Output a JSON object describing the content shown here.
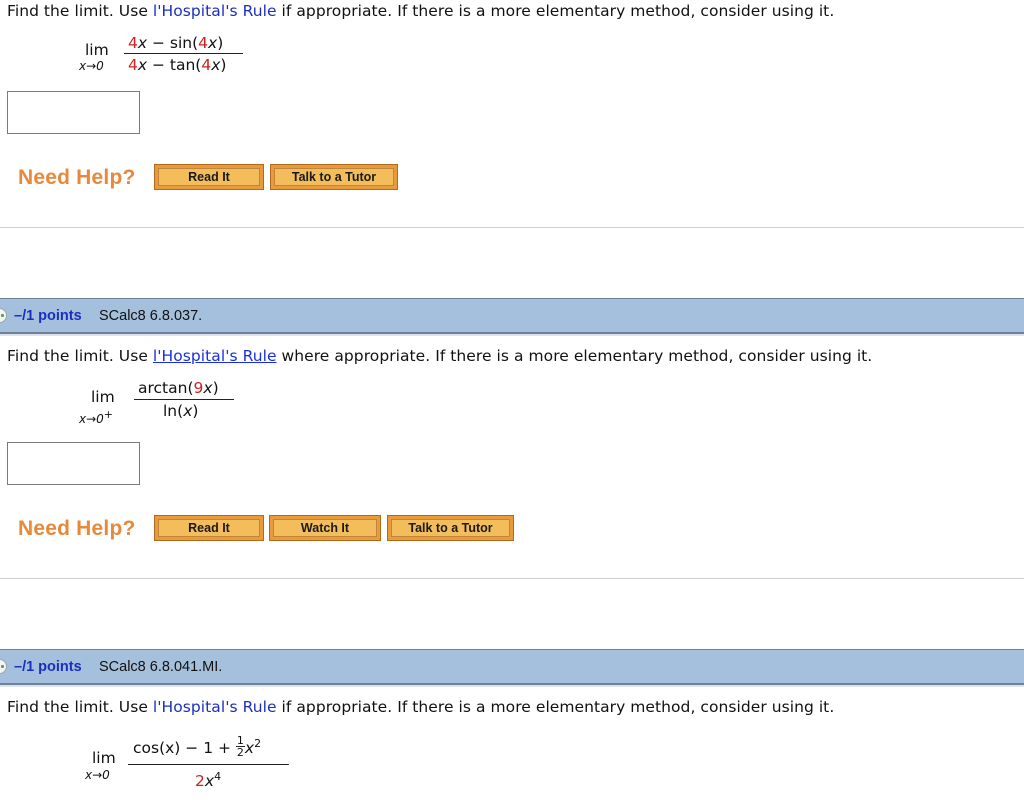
{
  "questions": [
    {
      "instruction": {
        "prefix": "Find the limit. Use ",
        "link": "l'Hospital's Rule",
        "suffix": " if appropriate. If there is a more elementary method, consider using it."
      },
      "limit": {
        "lim": "lim",
        "approach": "x→0",
        "numerator": [
          {
            "t": "4",
            "red": true
          },
          {
            "t": "x",
            "it": true
          },
          {
            "t": " − sin("
          },
          {
            "t": "4",
            "red": true
          },
          {
            "t": "x",
            "it": true
          },
          {
            "t": ")"
          }
        ],
        "denominator": [
          {
            "t": "4",
            "red": true
          },
          {
            "t": "x",
            "it": true
          },
          {
            "t": " − tan("
          },
          {
            "t": "4",
            "red": true
          },
          {
            "t": "x",
            "it": true
          },
          {
            "t": ")"
          }
        ]
      },
      "answer_value": "",
      "need_help": "Need Help?",
      "help_buttons": [
        "Read It",
        "Talk to a Tutor"
      ]
    },
    {
      "header": {
        "points": "–/1 points",
        "id": "SCalc8 6.8.037."
      },
      "instruction": {
        "prefix": "Find the limit. Use ",
        "link": "l'Hospital's Rule",
        "suffix": " where appropriate. If there is a more elementary method, consider using it."
      },
      "limit": {
        "lim": "lim",
        "approach": "x→0",
        "approach_sup": "+",
        "numerator": [
          {
            "t": "arctan("
          },
          {
            "t": "9",
            "red": true
          },
          {
            "t": "x",
            "it": true
          },
          {
            "t": ")"
          }
        ],
        "denominator": [
          {
            "t": "ln("
          },
          {
            "t": "x",
            "it": true
          },
          {
            "t": ")"
          }
        ]
      },
      "answer_value": "",
      "need_help": "Need Help?",
      "help_buttons": [
        "Read It",
        "Watch It",
        "Talk to a Tutor"
      ]
    },
    {
      "header": {
        "points": "–/1 points",
        "id": "SCalc8 6.8.041.MI."
      },
      "instruction": {
        "prefix": "Find the limit. Use ",
        "link": "l'Hospital's Rule",
        "suffix": " if appropriate. If there is a more elementary method, consider using it."
      },
      "limit": {
        "lim": "lim",
        "approach": "x→0",
        "numerator_text": "cos(x) − 1 + ",
        "numerator_frac": {
          "num": "1",
          "den": "2"
        },
        "numerator_tail": "x",
        "numerator_tail_sup": "2",
        "denominator_coef": "2",
        "denominator_var": "x",
        "denominator_sup": "4"
      }
    }
  ],
  "colors": {
    "link": "#1a2fbf",
    "math_highlight": "#cc2222",
    "need_help": "#e8893a",
    "button_fill": "#f2bd5a",
    "header_bar": "#a4c0dc",
    "points": "#1b2fbf"
  }
}
